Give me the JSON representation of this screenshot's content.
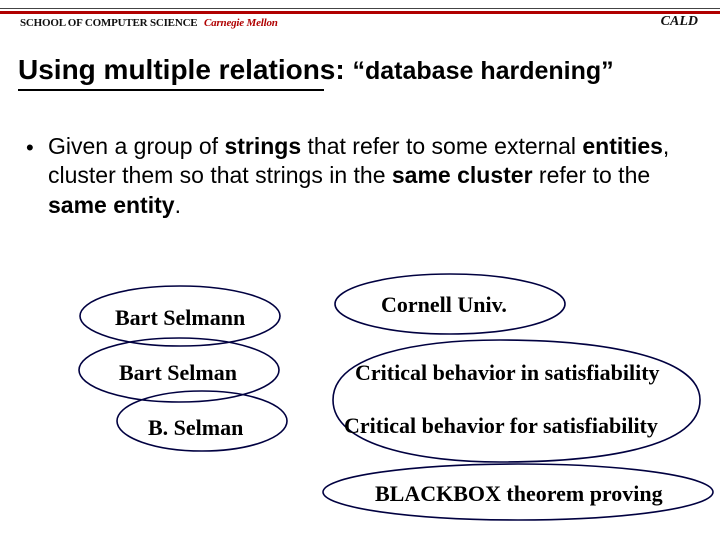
{
  "header": {
    "scs_text": "SCHOOL OF COMPUTER SCIENCE",
    "cm_text": "Carnegie Mellon",
    "cald_text": "CALD"
  },
  "title": {
    "main": "Using multiple relations:",
    "quoted": "“database hardening”"
  },
  "body": {
    "text_html": "Given a group of <b>strings</b> that refer to some external <b>entities</b>, cluster them so that strings in the <b>same cluster</b> refer to the <b>same entity</b>."
  },
  "ovals": {
    "left": [
      "Bart Selmann",
      "Bart Selman",
      "B. Selman"
    ],
    "right": [
      "Cornell Univ.",
      "Critical behavior in satisfiability",
      "Critical behavior for satisfiability",
      "BLACKBOX theorem proving"
    ]
  }
}
